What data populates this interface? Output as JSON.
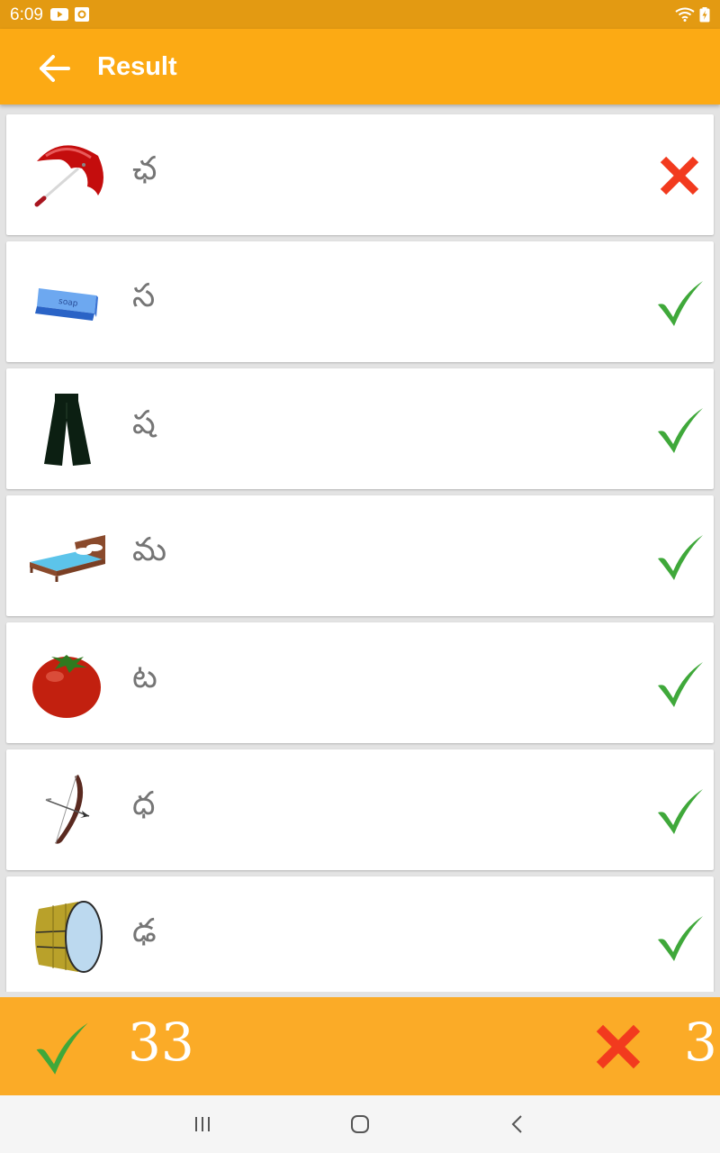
{
  "status_bar": {
    "time": "6:09",
    "icons": [
      "youtube-icon",
      "app-notification-icon",
      "wifi-icon",
      "battery-charging-icon"
    ]
  },
  "app_bar": {
    "title": "Result",
    "back_icon": "arrow-back-icon"
  },
  "results": [
    {
      "image": "umbrella",
      "letter": "ఛ",
      "correct": false
    },
    {
      "image": "soap",
      "image_text": "soap",
      "letter": "స",
      "correct": true
    },
    {
      "image": "pants",
      "letter": "ష",
      "correct": true
    },
    {
      "image": "bed",
      "letter": "మ",
      "correct": true
    },
    {
      "image": "tomato",
      "letter": "ట",
      "correct": true
    },
    {
      "image": "bow-and-arrow",
      "letter": "ధ",
      "correct": true
    },
    {
      "image": "drum",
      "letter": "ఢ",
      "correct": true
    }
  ],
  "summary": {
    "correct_count": "33",
    "wrong_count": "3"
  },
  "colors": {
    "status_bar": "#e39a12",
    "app_bar": "#fcaa14",
    "summary_bar": "#fbab27",
    "correct_green": "#3fa83a",
    "wrong_red": "#f23a1e"
  },
  "nav_bar": {
    "buttons": [
      "recent-apps-icon",
      "home-icon",
      "back-nav-icon"
    ]
  }
}
